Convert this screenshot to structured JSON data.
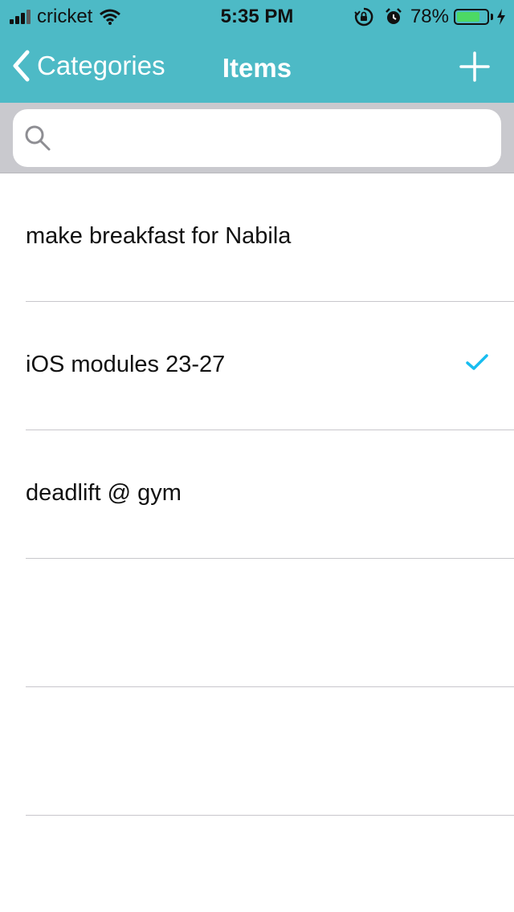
{
  "status_bar": {
    "carrier": "cricket",
    "time": "5:35 PM",
    "battery_percent": "78%",
    "battery_level": 0.78,
    "signal_bars_filled": 3,
    "signal_bars_total": 4
  },
  "nav": {
    "back_label": "Categories",
    "title": "Items",
    "accent_color": "#4DBAC6"
  },
  "search": {
    "value": "",
    "placeholder": ""
  },
  "items": [
    {
      "title": "make breakfast for Nabila",
      "done": false
    },
    {
      "title": "iOS modules 23-27",
      "done": true
    },
    {
      "title": "deadlift @ gym",
      "done": false
    },
    {
      "title": "",
      "done": false
    },
    {
      "title": "",
      "done": false
    }
  ],
  "colors": {
    "checkmark": "#17BDF0",
    "battery_fill": "#4CD964"
  },
  "icons": {
    "back": "chevron-left-icon",
    "add": "plus-icon",
    "search": "magnifier-icon",
    "done": "checkmark-icon"
  }
}
